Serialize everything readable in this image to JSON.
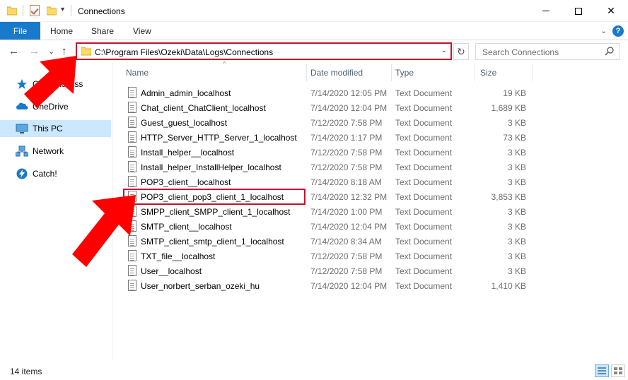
{
  "window": {
    "title": "Connections",
    "quick_access_dropdown": "▾",
    "minimize_icon": "minimize-icon",
    "maximize_icon": "maximize-icon",
    "close_label": "✕"
  },
  "ribbon": {
    "tabs": [
      "File",
      "Home",
      "Share",
      "View"
    ],
    "expand_label": "⌄",
    "help_label": "?"
  },
  "nav": {
    "back": "←",
    "forward": "→",
    "recent": "⌄",
    "up": "↑"
  },
  "address": {
    "path": "C:\\Program Files\\Ozeki\\Data\\Logs\\Connections",
    "dropdown": "⌄",
    "refresh": "↻"
  },
  "search": {
    "placeholder": "Search Connections"
  },
  "sidebar": {
    "items": [
      {
        "label": "Quick access",
        "icon": "star-icon"
      },
      {
        "label": "OneDrive",
        "icon": "cloud-icon"
      },
      {
        "label": "This PC",
        "icon": "computer-icon"
      },
      {
        "label": "Network",
        "icon": "network-icon"
      },
      {
        "label": "Catch!",
        "icon": "lightning-icon"
      }
    ]
  },
  "columns": {
    "name": "Name",
    "date": "Date modified",
    "type": "Type",
    "size": "Size",
    "sort_indicator": "^"
  },
  "files": [
    {
      "name": "Admin_admin_localhost",
      "date": "7/14/2020 12:05 PM",
      "type": "Text Document",
      "size": "19 KB"
    },
    {
      "name": "Chat_client_ChatClient_localhost",
      "date": "7/14/2020 12:04 PM",
      "type": "Text Document",
      "size": "1,689 KB"
    },
    {
      "name": "Guest_guest_localhost",
      "date": "7/12/2020 7:58 PM",
      "type": "Text Document",
      "size": "3 KB"
    },
    {
      "name": "HTTP_Server_HTTP_Server_1_localhost",
      "date": "7/14/2020 1:17 PM",
      "type": "Text Document",
      "size": "73 KB"
    },
    {
      "name": "Install_helper__localhost",
      "date": "7/12/2020 7:58 PM",
      "type": "Text Document",
      "size": "3 KB"
    },
    {
      "name": "Install_helper_InstallHelper_localhost",
      "date": "7/12/2020 7:58 PM",
      "type": "Text Document",
      "size": "3 KB"
    },
    {
      "name": "POP3_client__localhost",
      "date": "7/14/2020 8:18 AM",
      "type": "Text Document",
      "size": "3 KB"
    },
    {
      "name": "POP3_client_pop3_client_1_localhost",
      "date": "7/14/2020 12:32 PM",
      "type": "Text Document",
      "size": "3,853 KB"
    },
    {
      "name": "SMPP_client_SMPP_client_1_localhost",
      "date": "7/14/2020 1:00 PM",
      "type": "Text Document",
      "size": "3 KB"
    },
    {
      "name": "SMTP_client__localhost",
      "date": "7/14/2020 12:04 PM",
      "type": "Text Document",
      "size": "3 KB"
    },
    {
      "name": "SMTP_client_smtp_client_1_localhost",
      "date": "7/14/2020 8:34 AM",
      "type": "Text Document",
      "size": "3 KB"
    },
    {
      "name": "TXT_file__localhost",
      "date": "7/12/2020 7:58 PM",
      "type": "Text Document",
      "size": "3 KB"
    },
    {
      "name": "User__localhost",
      "date": "7/12/2020 7:58 PM",
      "type": "Text Document",
      "size": "3 KB"
    },
    {
      "name": "User_norbert_serban_ozeki_hu",
      "date": "7/14/2020 12:04 PM",
      "type": "Text Document",
      "size": "1,410 KB"
    }
  ],
  "status": {
    "count": "14 items"
  },
  "colors": {
    "accent": "#1979ca",
    "selection": "#cce8ff",
    "annotation_red": "#ff0000",
    "annotation_border": "#c8102e"
  }
}
